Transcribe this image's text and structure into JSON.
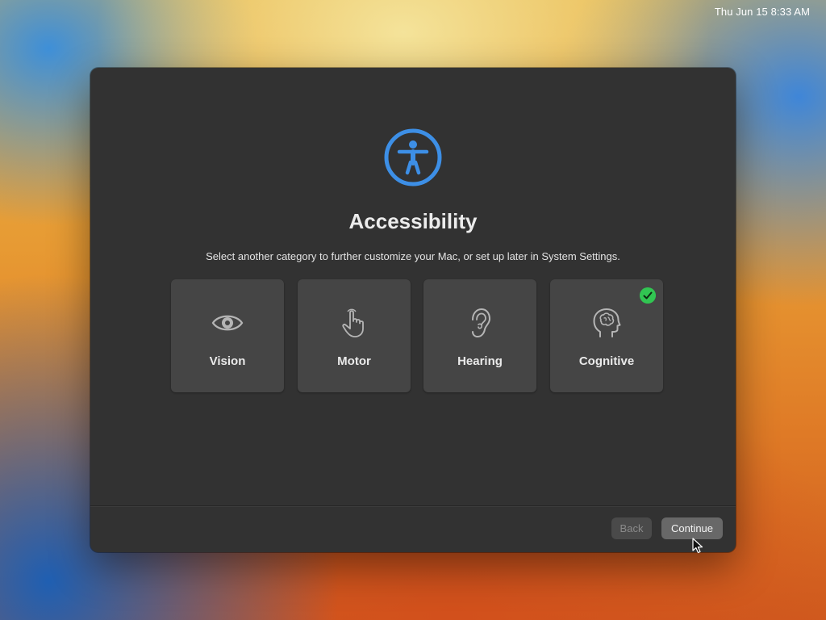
{
  "menubar": {
    "clock": "Thu Jun 15  8:33 AM"
  },
  "window": {
    "hero_icon": "accessibility-icon",
    "title": "Accessibility",
    "subtitle": "Select another category to further customize your Mac, or set up later in System Settings.",
    "categories": [
      {
        "label": "Vision",
        "icon": "eye-icon",
        "selected": false
      },
      {
        "label": "Motor",
        "icon": "pointing-hand-icon",
        "selected": false
      },
      {
        "label": "Hearing",
        "icon": "ear-icon",
        "selected": false
      },
      {
        "label": "Cognitive",
        "icon": "brain-head-icon",
        "selected": true
      }
    ],
    "buttons": {
      "back": "Back",
      "continue": "Continue"
    }
  },
  "colors": {
    "accent_blue": "#3d8fe6",
    "check_green": "#31c552",
    "window_bg": "#323232",
    "card_bg": "#454545"
  }
}
